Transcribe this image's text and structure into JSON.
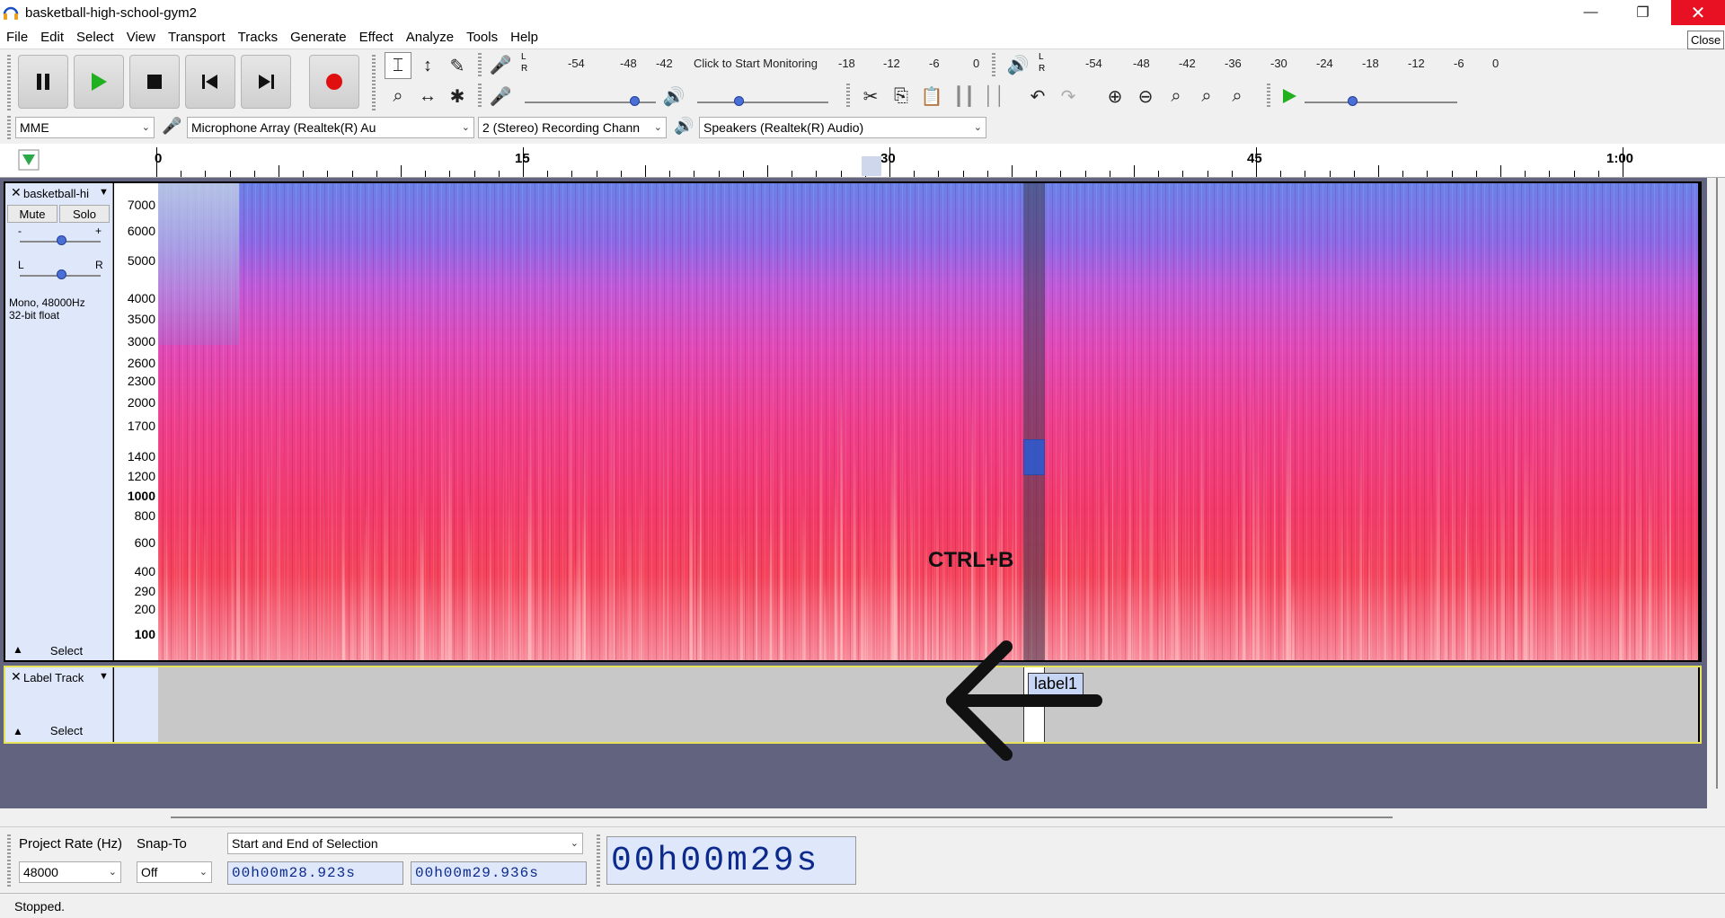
{
  "window": {
    "title": "basketball-high-school-gym2",
    "close_tooltip": "Close"
  },
  "menu": [
    "File",
    "Edit",
    "Select",
    "View",
    "Transport",
    "Tracks",
    "Generate",
    "Effect",
    "Analyze",
    "Tools",
    "Help"
  ],
  "meters": {
    "record_scale": [
      "-54",
      "-48",
      "-42",
      "Click to Start Monitoring",
      "-18",
      "-12",
      "-6",
      "0"
    ],
    "play_scale": [
      "-54",
      "-48",
      "-42",
      "-36",
      "-30",
      "-24",
      "-18",
      "-12",
      "-6",
      "0"
    ],
    "lr": [
      "L",
      "R"
    ]
  },
  "devices": {
    "host": "MME",
    "input": "Microphone Array (Realtek(R) Au",
    "channels": "2 (Stereo) Recording Chann",
    "output": "Speakers (Realtek(R) Audio)"
  },
  "ruler": {
    "labels": [
      "0",
      "15",
      "30",
      "45",
      "1:00"
    ]
  },
  "audio_track": {
    "name": "basketball-hi",
    "mute": "Mute",
    "solo": "Solo",
    "gain_minus": "-",
    "gain_plus": "+",
    "pan_l": "L",
    "pan_r": "R",
    "info_line1": "Mono, 48000Hz",
    "info_line2": "32-bit float",
    "select": "Select",
    "freq_labels": [
      "7000",
      "6000",
      "5000",
      "4000",
      "3500",
      "3000",
      "2600",
      "2300",
      "2000",
      "1700",
      "1400",
      "1200",
      "1000",
      "800",
      "600",
      "400",
      "290",
      "200",
      "100"
    ]
  },
  "annotation": {
    "shortcut": "CTRL+B"
  },
  "label_track": {
    "name": "Label Track",
    "select": "Select",
    "label_text": "label1"
  },
  "selection_bar": {
    "project_rate_label": "Project Rate (Hz)",
    "snap_to_label": "Snap-To",
    "selection_mode": "Start and End of Selection",
    "project_rate": "48000",
    "snap_to": "Off",
    "start_time": "00h00m28.923s",
    "end_time": "00h00m29.936s",
    "audio_position": "00h00m29s"
  },
  "status": {
    "text": "Stopped."
  }
}
